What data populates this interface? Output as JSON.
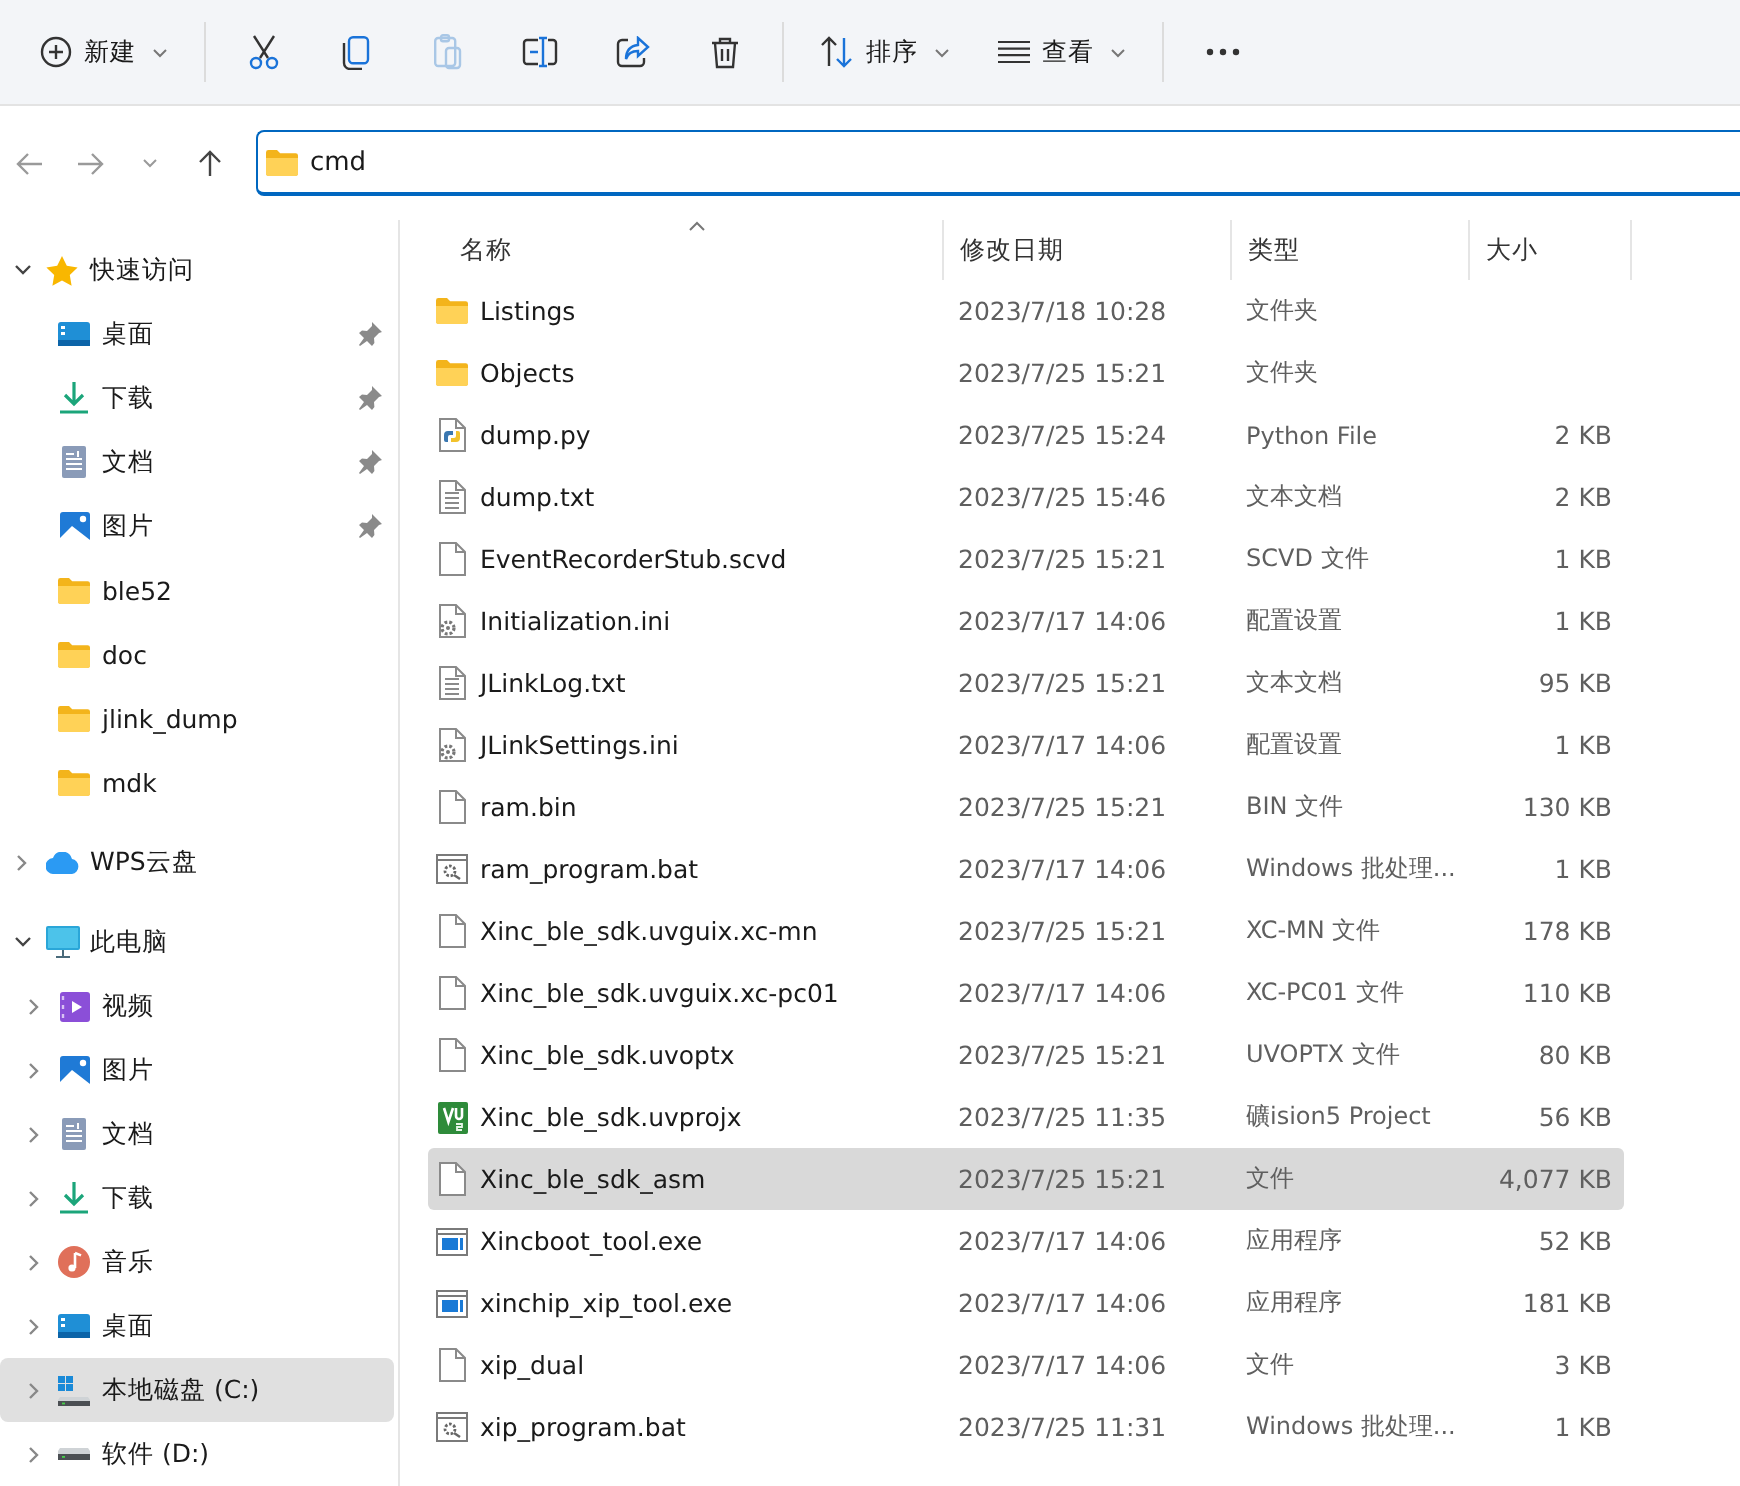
{
  "toolbar": {
    "items": [
      {
        "kind": "new",
        "label": "新建",
        "caret": true,
        "disabled": false
      },
      {
        "kind": "cut",
        "disabled": false
      },
      {
        "kind": "copy",
        "disabled": false
      },
      {
        "kind": "paste",
        "disabled": true
      },
      {
        "kind": "rename",
        "disabled": false
      },
      {
        "kind": "share",
        "disabled": false
      },
      {
        "kind": "delete",
        "disabled": false
      },
      {
        "kind": "sort",
        "label": "排序",
        "caret": true,
        "disabled": false
      },
      {
        "kind": "view",
        "label": "查看",
        "caret": true,
        "disabled": false
      },
      {
        "kind": "more",
        "disabled": false
      }
    ]
  },
  "address_bar": {
    "path": "cmd"
  },
  "sidebar": {
    "sections": [
      {
        "label": "快速访问",
        "kind": "star",
        "expandable": true,
        "expanded": true,
        "selected": false,
        "children": [
          {
            "label": "桌面",
            "kind": "desktop",
            "pinned": true,
            "selected": false
          },
          {
            "label": "下载",
            "kind": "download",
            "pinned": true,
            "selected": false
          },
          {
            "label": "文档",
            "kind": "document",
            "pinned": true,
            "selected": false
          },
          {
            "label": "图片",
            "kind": "pictures",
            "pinned": true,
            "selected": false
          },
          {
            "label": "ble52",
            "kind": "folder",
            "pinned": false,
            "selected": false
          },
          {
            "label": "doc",
            "kind": "folder",
            "pinned": false,
            "selected": false
          },
          {
            "label": "jlink_dump",
            "kind": "folder",
            "pinned": false,
            "selected": false
          },
          {
            "label": "mdk",
            "kind": "folder",
            "pinned": false,
            "selected": false
          }
        ]
      },
      {
        "label": "WPS云盘",
        "kind": "cloud",
        "expandable": true,
        "expanded": false,
        "selected": false
      },
      {
        "label": "此电脑",
        "kind": "pc",
        "expandable": true,
        "expanded": true,
        "selected": false,
        "children": [
          {
            "label": "视频",
            "kind": "video",
            "expanded": false,
            "selected": false
          },
          {
            "label": "图片",
            "kind": "pictures",
            "expanded": false,
            "selected": false
          },
          {
            "label": "文档",
            "kind": "document",
            "expanded": false,
            "selected": false
          },
          {
            "label": "下载",
            "kind": "download",
            "expanded": false,
            "selected": false
          },
          {
            "label": "音乐",
            "kind": "music",
            "expanded": false,
            "selected": false
          },
          {
            "label": "桌面",
            "kind": "desktop",
            "expanded": false,
            "selected": false
          },
          {
            "label": "本地磁盘 (C:)",
            "kind": "drive_windows",
            "expanded": false,
            "selected": true
          },
          {
            "label": "软件 (D:)",
            "kind": "drive",
            "expanded": false,
            "selected": false
          }
        ]
      }
    ]
  },
  "file_list": {
    "columns": [
      {
        "label": "名称",
        "sorted": true
      },
      {
        "label": "修改日期",
        "sorted": false
      },
      {
        "label": "类型",
        "sorted": false
      },
      {
        "label": "大小",
        "sorted": false
      }
    ],
    "rows": [
      {
        "kind": "folder",
        "name": "Listings",
        "date": "2023/7/18 10:28",
        "type": "文件夹",
        "selected": false
      },
      {
        "kind": "folder",
        "name": "Objects",
        "date": "2023/7/25 15:21",
        "type": "文件夹",
        "selected": false
      },
      {
        "kind": "python",
        "name": "dump.py",
        "date": "2023/7/25 15:24",
        "type": "Python File",
        "size": "2 KB",
        "selected": false
      },
      {
        "kind": "text",
        "name": "dump.txt",
        "date": "2023/7/25 15:46",
        "type": "文本文档",
        "size": "2 KB",
        "selected": false
      },
      {
        "kind": "blank",
        "name": "EventRecorderStub.scvd",
        "date": "2023/7/25 15:21",
        "type": "SCVD 文件",
        "size": "1 KB",
        "selected": false
      },
      {
        "kind": "settings",
        "name": "Initialization.ini",
        "date": "2023/7/17 14:06",
        "type": "配置设置",
        "size": "1 KB",
        "selected": false
      },
      {
        "kind": "text",
        "name": "JLinkLog.txt",
        "date": "2023/7/25 15:21",
        "type": "文本文档",
        "size": "95 KB",
        "selected": false
      },
      {
        "kind": "settings",
        "name": "JLinkSettings.ini",
        "date": "2023/7/17 14:06",
        "type": "配置设置",
        "size": "1 KB",
        "selected": false
      },
      {
        "kind": "blank",
        "name": "ram.bin",
        "date": "2023/7/25 15:21",
        "type": "BIN 文件",
        "size": "130 KB",
        "selected": false
      },
      {
        "kind": "batch",
        "name": "ram_program.bat",
        "date": "2023/7/17 14:06",
        "type": "Windows 批处理...",
        "size": "1 KB",
        "selected": false
      },
      {
        "kind": "blank",
        "name": "Xinc_ble_sdk.uvguix.xc-mn",
        "date": "2023/7/25 15:21",
        "type": "XC-MN 文件",
        "size": "178 KB",
        "selected": false
      },
      {
        "kind": "blank",
        "name": "Xinc_ble_sdk.uvguix.xc-pc01",
        "date": "2023/7/17 14:06",
        "type": "XC-PC01 文件",
        "size": "110 KB",
        "selected": false
      },
      {
        "kind": "blank",
        "name": "Xinc_ble_sdk.uvoptx",
        "date": "2023/7/25 15:21",
        "type": "UVOPTX 文件",
        "size": "80 KB",
        "selected": false
      },
      {
        "kind": "uvision",
        "name": "Xinc_ble_sdk.uvprojx",
        "date": "2023/7/25 11:35",
        "type": "礦ision5 Project",
        "size": "56 KB",
        "selected": false
      },
      {
        "kind": "blank",
        "name": "Xinc_ble_sdk_asm",
        "date": "2023/7/25 15:21",
        "type": "文件",
        "size": "4,077 KB",
        "selected": true
      },
      {
        "kind": "exe",
        "name": "Xincboot_tool.exe",
        "date": "2023/7/17 14:06",
        "type": "应用程序",
        "size": "52 KB",
        "selected": false
      },
      {
        "kind": "exe",
        "name": "xinchip_xip_tool.exe",
        "date": "2023/7/17 14:06",
        "type": "应用程序",
        "size": "181 KB",
        "selected": false
      },
      {
        "kind": "blank",
        "name": "xip_dual",
        "date": "2023/7/17 14:06",
        "type": "文件",
        "size": "3 KB",
        "selected": false
      },
      {
        "kind": "batch",
        "name": "xip_program.bat",
        "date": "2023/7/25 11:31",
        "type": "Windows 批处理...",
        "size": "1 KB",
        "selected": false
      }
    ]
  }
}
